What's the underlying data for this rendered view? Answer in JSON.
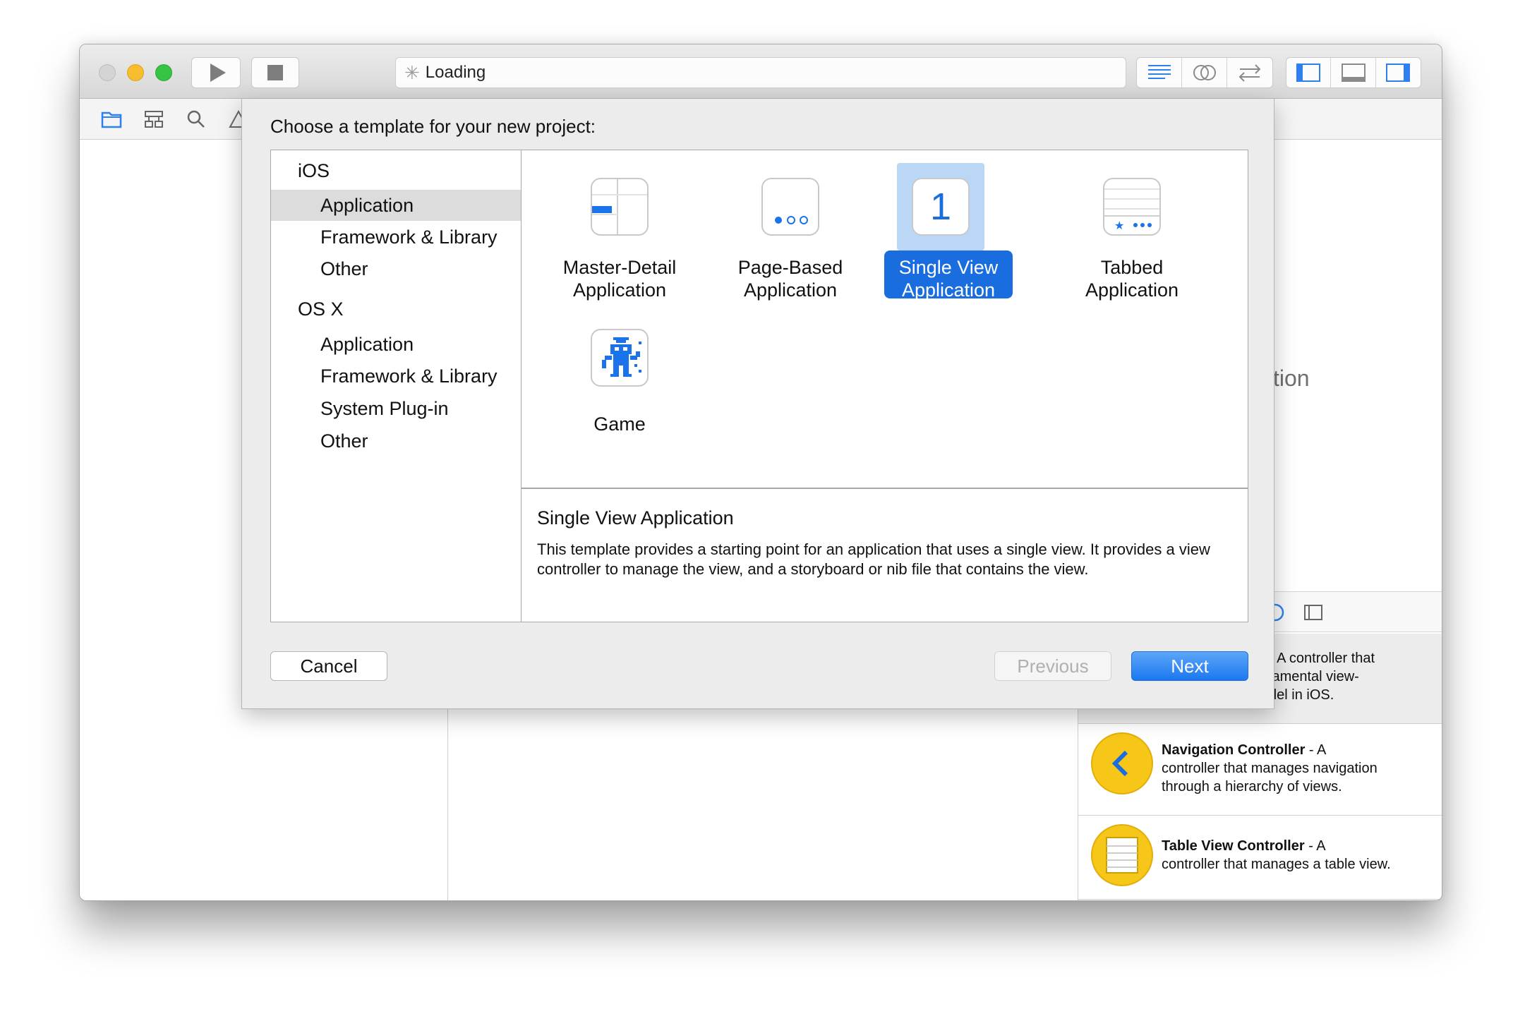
{
  "toolbar": {
    "activity_text": "Loading"
  },
  "sheet": {
    "title": "Choose a template for your new project:",
    "sidebar": {
      "sections": [
        {
          "label": "iOS",
          "items": [
            "Application",
            "Framework & Library",
            "Other"
          ]
        },
        {
          "label": "OS X",
          "items": [
            "Application",
            "Framework & Library",
            "System Plug-in",
            "Other"
          ]
        }
      ],
      "selected": "iOS / Application"
    },
    "templates": [
      {
        "label_line1": "Master-Detail",
        "label_line2": "Application"
      },
      {
        "label_line1": "Page-Based",
        "label_line2": "Application"
      },
      {
        "label_line1": "Single View",
        "label_line2": "Application",
        "icon_text": "1"
      },
      {
        "label_line1": "Tabbed",
        "label_line2": "Application"
      },
      {
        "label_line1": "Game",
        "label_line2": ""
      }
    ],
    "selected_template": "Single View Application",
    "description": {
      "title": "Single View Application",
      "body": "This template provides a starting point for an application that uses a single view. It provides a view controller to manage the view, and a storyboard or nib file that contains the view."
    },
    "buttons": {
      "cancel": "Cancel",
      "previous": "Previous",
      "next": "Next"
    }
  },
  "background": {
    "faded_title": "ction",
    "library": [
      {
        "name": "",
        "text": "- A controller that",
        "text2": "lamental view-",
        "text3": "del in iOS."
      },
      {
        "name": "Navigation Controller",
        "text": " - A",
        "text2": "controller that manages navigation",
        "text3": "through a hierarchy of views."
      },
      {
        "name": "Table View Controller",
        "text": " - A",
        "text2": "controller that manages a table view.",
        "text3": ""
      }
    ]
  },
  "colors": {
    "accent": "#1a6dde",
    "selection_bg": "#bad7f5",
    "traffic_min": "#f6be2e",
    "traffic_zoom": "#37c445",
    "library_icon": "#f6c619"
  },
  "icons": {
    "run": "play-icon",
    "stop": "stop-icon",
    "activity": "spinner-icon",
    "editor_standard": "lines-icon",
    "editor_assistant": "overlap-circles-icon",
    "editor_version": "arrows-icon",
    "nav_toggle": "left-panel-icon",
    "debug_toggle": "bottom-panel-icon",
    "util_toggle": "right-panel-icon"
  }
}
